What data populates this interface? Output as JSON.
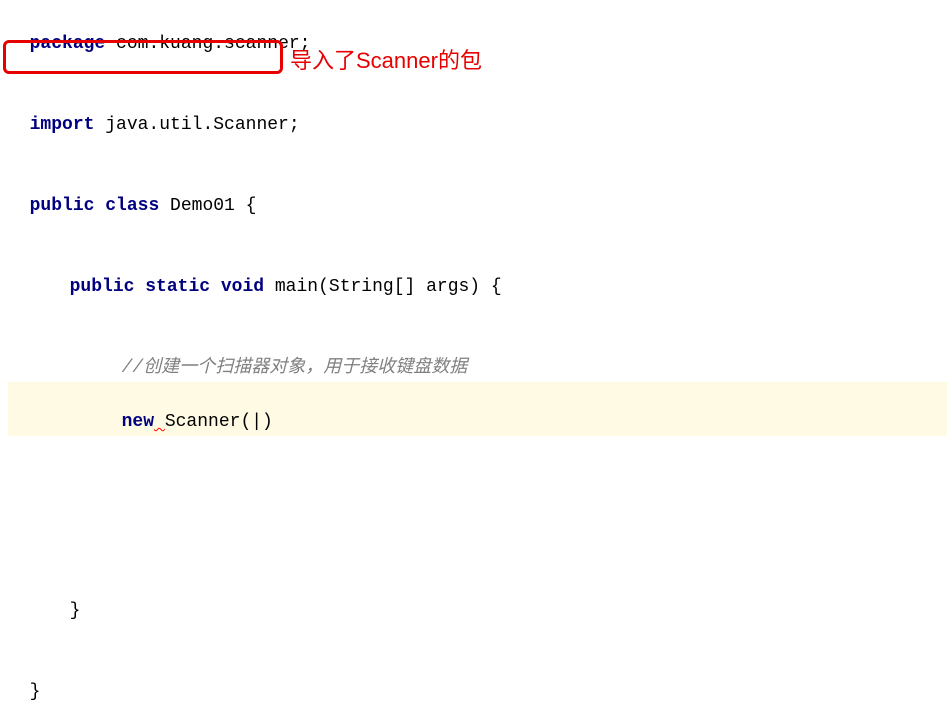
{
  "code": {
    "line1_kw": "package",
    "line1_rest": " com.kuang.scanner;",
    "line3_kw": "import",
    "line3_rest": " java.util.Scanner;",
    "line5_kw1": "public",
    "line5_kw2": "class",
    "line5_rest": " Demo01 {",
    "line7_kw1": "public",
    "line7_kw2": "static",
    "line7_kw3": "void",
    "line7_rest": " main(String[] args) {",
    "line9_comment": "//创建一个扫描器对象，用于接收键盘数据",
    "line10_kw": "new",
    "line10_squiggle": " ",
    "line10_rest": "Scanner(|)",
    "line_close1": "}",
    "line_close2": "}"
  },
  "annotation": {
    "text": "导入了Scanner的包"
  }
}
